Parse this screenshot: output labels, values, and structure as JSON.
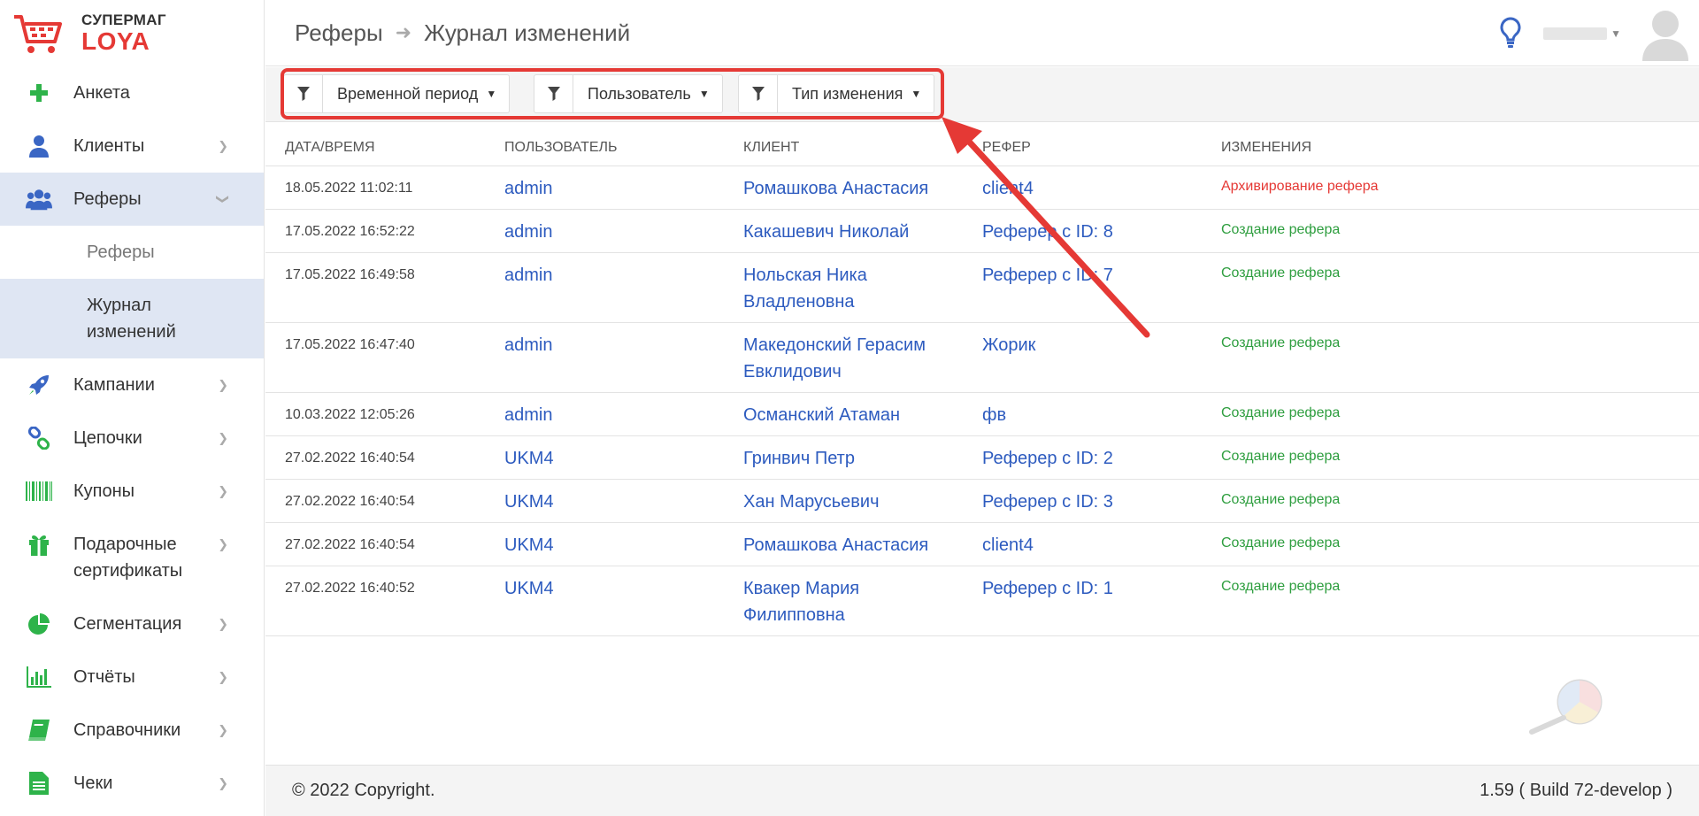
{
  "logo": {
    "line1": "СУПЕРМАГ",
    "line2": "LOYA"
  },
  "sidebar": {
    "items": [
      {
        "label": "Анкета",
        "icon": "plus-icon"
      },
      {
        "label": "Клиенты",
        "icon": "user-icon"
      },
      {
        "label": "Реферы",
        "icon": "users-icon"
      },
      {
        "label": "Кампании",
        "icon": "rocket-icon"
      },
      {
        "label": "Цепочки",
        "icon": "chain-icon"
      },
      {
        "label": "Купоны",
        "icon": "barcode-icon"
      },
      {
        "label": "Подарочные сертификаты",
        "icon": "gift-icon"
      },
      {
        "label": "Сегментация",
        "icon": "pie-chart-icon"
      },
      {
        "label": "Отчёты",
        "icon": "bar-chart-icon"
      },
      {
        "label": "Справочники",
        "icon": "book-icon"
      },
      {
        "label": "Чеки",
        "icon": "receipt-icon"
      }
    ],
    "sub_items": [
      {
        "label": "Реферы"
      },
      {
        "label": "Журнал изменений"
      }
    ]
  },
  "header": {
    "breadcrumb_root": "Реферы",
    "breadcrumb_current": "Журнал изменений"
  },
  "filters": [
    {
      "label": "Временной период"
    },
    {
      "label": "Пользователь"
    },
    {
      "label": "Тип изменения"
    }
  ],
  "table": {
    "columns": [
      "Дата/время",
      "Пользователь",
      "Клиент",
      "Рефер",
      "Изменения"
    ],
    "rows": [
      {
        "date": "18.05.2022 11:02:11",
        "user": "admin",
        "client": "Ромашкова Анастасия",
        "referrer": "client4",
        "change": "Архивирование рефера",
        "status": "red"
      },
      {
        "date": "17.05.2022 16:52:22",
        "user": "admin",
        "client": "Какашевич Николай",
        "referrer": "Реферер с ID: 8",
        "change": "Создание рефера",
        "status": "green"
      },
      {
        "date": "17.05.2022 16:49:58",
        "user": "admin",
        "client": "Нольская Ника Владленовна",
        "referrer": "Реферер с ID: 7",
        "change": "Создание рефера",
        "status": "green"
      },
      {
        "date": "17.05.2022 16:47:40",
        "user": "admin",
        "client": "Македонский Герасим Евклидович",
        "referrer": "Жорик",
        "change": "Создание рефера",
        "status": "green"
      },
      {
        "date": "10.03.2022 12:05:26",
        "user": "admin",
        "client": "Османский Атаман",
        "referrer": "фв",
        "change": "Создание рефера",
        "status": "green"
      },
      {
        "date": "27.02.2022 16:40:54",
        "user": "UKM4",
        "client": "Гринвич Петр",
        "referrer": "Реферер с ID: 2",
        "change": "Создание рефера",
        "status": "green"
      },
      {
        "date": "27.02.2022 16:40:54",
        "user": "UKM4",
        "client": "Хан Марусьевич",
        "referrer": "Реферер с ID: 3",
        "change": "Создание рефера",
        "status": "green"
      },
      {
        "date": "27.02.2022 16:40:54",
        "user": "UKM4",
        "client": "Ромашкова Анастасия",
        "referrer": "client4",
        "change": "Создание рефера",
        "status": "green"
      },
      {
        "date": "27.02.2022 16:40:52",
        "user": "UKM4",
        "client": "Квакер Мария Филипповна",
        "referrer": "Реферер с ID: 1",
        "change": "Создание рефера",
        "status": "green"
      }
    ]
  },
  "footer": {
    "copyright": "© 2022 Copyright.",
    "version": "1.59 ( Build 72-develop )"
  },
  "colors": {
    "brand_red": "#e53935",
    "link_blue": "#2d5bbf",
    "status_green": "#2e9e3f",
    "active_bg": "#dfe6f3"
  }
}
